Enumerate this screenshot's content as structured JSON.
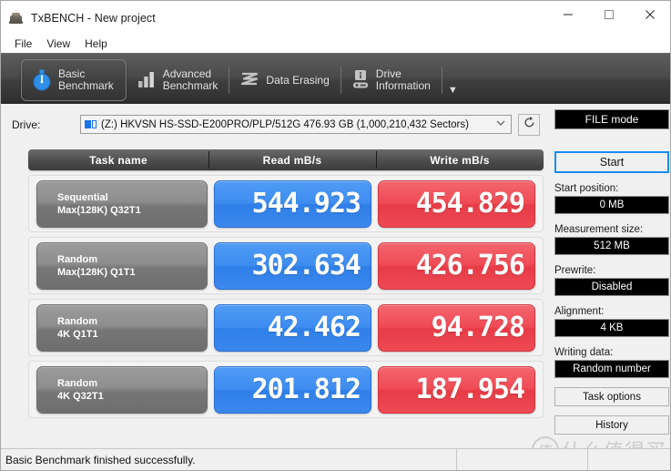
{
  "window": {
    "title": "TxBENCH - New project",
    "app_icon": "txbench-logo-icon",
    "minimize_label": "─",
    "maximize_label": "□",
    "close_label": "✕"
  },
  "menu": {
    "items": [
      {
        "label": "File"
      },
      {
        "label": "View"
      },
      {
        "label": "Help"
      }
    ]
  },
  "tabs": {
    "items": [
      {
        "label": "Basic\nBenchmark",
        "icon": "stopwatch-icon",
        "active": true
      },
      {
        "label": "Advanced\nBenchmark",
        "icon": "bar-chart-icon",
        "active": false
      },
      {
        "label": "Data Erasing",
        "icon": "erase-wave-icon",
        "active": false
      },
      {
        "label": "Drive\nInformation",
        "icon": "drive-info-icon",
        "active": false
      }
    ],
    "overflow_label": "▼"
  },
  "drive": {
    "label": "Drive:",
    "value": "(Z:) HKVSN HS-SSD-E200PRO/PLP/512G  476.93 GB (1,000,210,432 Sectors)",
    "chevron": "⌄",
    "refresh_icon": "refresh-icon"
  },
  "results": {
    "columns": [
      "Task name",
      "Read mB/s",
      "Write mB/s"
    ],
    "rows": [
      {
        "name_line1": "Sequential",
        "name_line2": "Max(128K) Q32T1",
        "read": "544.923",
        "write": "454.829"
      },
      {
        "name_line1": "Random",
        "name_line2": "Max(128K) Q1T1",
        "read": "302.634",
        "write": "426.756"
      },
      {
        "name_line1": "Random",
        "name_line2": "4K Q1T1",
        "read": "42.462",
        "write": "94.728"
      },
      {
        "name_line1": "Random",
        "name_line2": "4K Q32T1",
        "read": "201.812",
        "write": "187.954"
      }
    ]
  },
  "sidebar": {
    "mode_button": "FILE mode",
    "start_button": "Start",
    "fields": [
      {
        "label": "Start position:",
        "value": "0 MB"
      },
      {
        "label": "Measurement size:",
        "value": "512 MB"
      },
      {
        "label": "Prewrite:",
        "value": "Disabled"
      },
      {
        "label": "Alignment:",
        "value": "4 KB"
      },
      {
        "label": "Writing data:",
        "value": "Random number"
      }
    ],
    "task_options_button": "Task options",
    "history_button": "History"
  },
  "statusbar": {
    "message": "Basic Benchmark finished successfully."
  },
  "watermark": {
    "text": "什么值得买",
    "mark": "值"
  },
  "colors": {
    "read_accent": "#3d8cf0",
    "write_accent": "#ef4a54",
    "start_border": "#1a8cf0",
    "tabstrip": "#4a4a4a",
    "field_bg": "#000000"
  }
}
